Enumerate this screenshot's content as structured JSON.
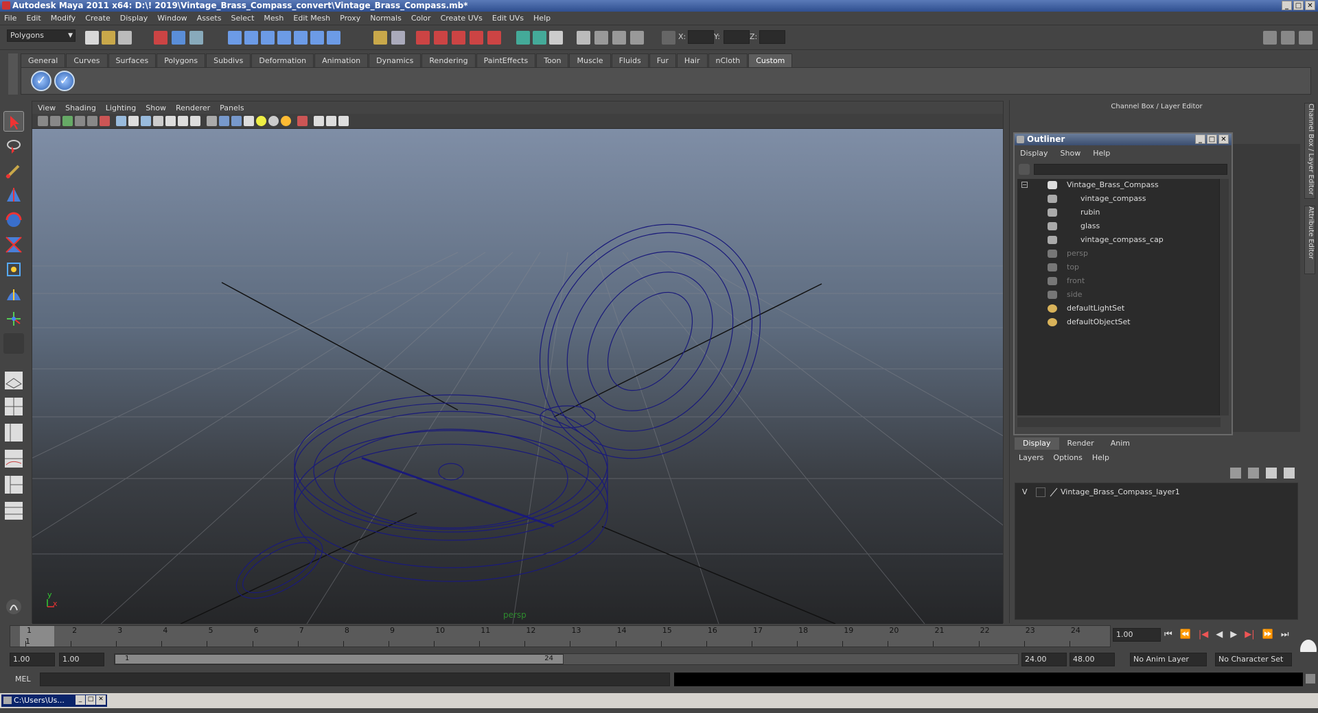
{
  "window": {
    "title": "Autodesk Maya 2011 x64: D:\\! 2019\\Vintage_Brass_Compass_convert\\Vintage_Brass_Compass.mb*",
    "controls": [
      "_",
      "□",
      "✕"
    ]
  },
  "menubar": [
    "File",
    "Edit",
    "Modify",
    "Create",
    "Display",
    "Window",
    "Assets",
    "Select",
    "Mesh",
    "Edit Mesh",
    "Proxy",
    "Normals",
    "Color",
    "Create UVs",
    "Edit UVs",
    "Help"
  ],
  "statusline": {
    "menu_set": "Polygons",
    "x_label": "X:",
    "y_label": "Y:",
    "z_label": "Z:"
  },
  "shelf": {
    "tabs": [
      "General",
      "Curves",
      "Surfaces",
      "Polygons",
      "Subdivs",
      "Deformation",
      "Animation",
      "Dynamics",
      "Rendering",
      "PaintEffects",
      "Toon",
      "Muscle",
      "Fluids",
      "Fur",
      "Hair",
      "nCloth",
      "Custom"
    ],
    "active_tab": "Custom",
    "buttons": [
      "check-icon",
      "check-icon"
    ]
  },
  "viewport": {
    "menu": [
      "View",
      "Shading",
      "Lighting",
      "Show",
      "Renderer",
      "Panels"
    ],
    "camera": "persp",
    "axis_y": "y",
    "axis_x": "x",
    "wire_color": "#1a1a7a"
  },
  "right_panel": {
    "header": "Channel Box / Layer Editor",
    "side_tab_1": "Channel Box / Layer Editor",
    "side_tab_2": "Attribute Editor"
  },
  "outliner": {
    "title": "Outliner",
    "menu": [
      "Display",
      "Show",
      "Help"
    ],
    "items": [
      {
        "label": "Vintage_Brass_Compass",
        "indent": 0,
        "dim": false
      },
      {
        "label": "vintage_compass",
        "indent": 1,
        "dim": false
      },
      {
        "label": "rubin",
        "indent": 1,
        "dim": false
      },
      {
        "label": "glass",
        "indent": 1,
        "dim": false
      },
      {
        "label": "vintage_compass_cap",
        "indent": 1,
        "dim": false
      },
      {
        "label": "persp",
        "indent": 0,
        "dim": true
      },
      {
        "label": "top",
        "indent": 0,
        "dim": true
      },
      {
        "label": "front",
        "indent": 0,
        "dim": true
      },
      {
        "label": "side",
        "indent": 0,
        "dim": true
      },
      {
        "label": "defaultLightSet",
        "indent": 0,
        "dim": false
      },
      {
        "label": "defaultObjectSet",
        "indent": 0,
        "dim": false
      }
    ]
  },
  "layer_editor": {
    "tabs": [
      "Display",
      "Render",
      "Anim"
    ],
    "active_tab": "Display",
    "menu": [
      "Layers",
      "Options",
      "Help"
    ],
    "layer_visibility": "V",
    "layer_name": "Vintage_Brass_Compass_layer1"
  },
  "timeline": {
    "ticks": [
      "1",
      "2",
      "3",
      "4",
      "5",
      "6",
      "7",
      "8",
      "9",
      "10",
      "11",
      "12",
      "13",
      "14",
      "15",
      "16",
      "17",
      "18",
      "19",
      "20",
      "21",
      "22",
      "23",
      "24"
    ],
    "current_frame_marker": "1",
    "current_frame": "1.00",
    "playback_controls": [
      "⏮",
      "⏪",
      "|◀",
      "◀",
      "▶",
      "▶|",
      "⏩",
      "⏭"
    ]
  },
  "range": {
    "start_time": "1.00",
    "playback_start": "1.00",
    "range_start_label": "1",
    "range_end_label": "24",
    "playback_end": "24.00",
    "end_time": "48.00",
    "anim_layer": "No Anim Layer",
    "character_set": "No Character Set"
  },
  "command_line": {
    "label": "MEL"
  },
  "taskbar": {
    "item": "C:\\Users\\Us..."
  }
}
